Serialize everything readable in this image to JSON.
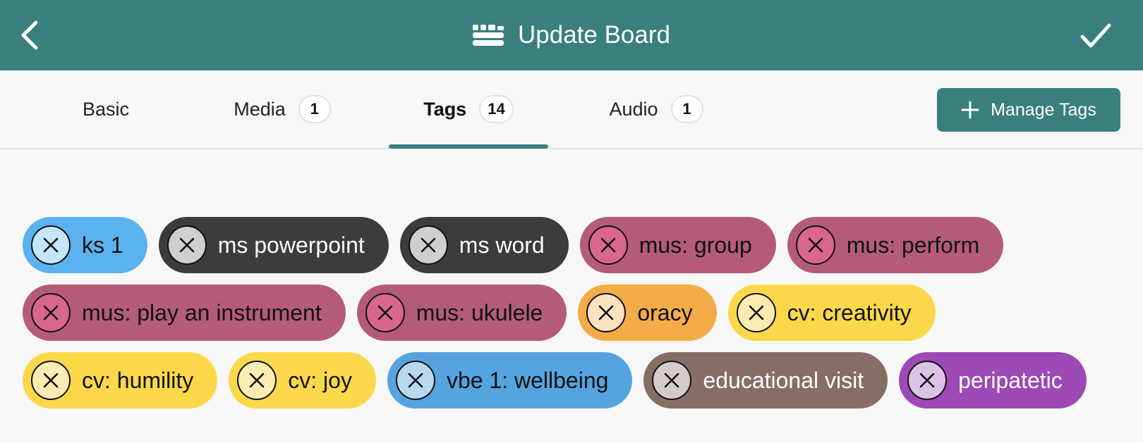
{
  "header": {
    "title": "Update Board",
    "back_icon": "chevron-left-icon",
    "board_icon": "board-icon",
    "confirm_icon": "checkmark-icon",
    "bg_color": "#397f7e"
  },
  "tabs": [
    {
      "label": "Basic",
      "count": null,
      "active": false
    },
    {
      "label": "Media",
      "count": "1",
      "active": false
    },
    {
      "label": "Tags",
      "count": "14",
      "active": true
    },
    {
      "label": "Audio",
      "count": "1",
      "active": false
    }
  ],
  "manage_tags": {
    "label": "Manage Tags",
    "icon": "plus-icon"
  },
  "tags": [
    {
      "label": "ks 1",
      "bg": "#5bb2ef",
      "circle": "#c4e5fa",
      "text": "#111111"
    },
    {
      "label": "ms powerpoint",
      "bg": "#3c3c3c",
      "circle": "#cfcfcf",
      "text": "#ffffff"
    },
    {
      "label": "ms word",
      "bg": "#3c3c3c",
      "circle": "#cfcfcf",
      "text": "#ffffff"
    },
    {
      "label": "mus: group",
      "bg": "#b45b7b",
      "circle": "#d8668f",
      "text": "#111111"
    },
    {
      "label": "mus: perform",
      "bg": "#b45b7b",
      "circle": "#d8668f",
      "text": "#111111"
    },
    {
      "label": "mus: play an instrument",
      "bg": "#b45b7b",
      "circle": "#d8668f",
      "text": "#111111"
    },
    {
      "label": "mus: ukulele",
      "bg": "#b45b7b",
      "circle": "#d8668f",
      "text": "#111111"
    },
    {
      "label": "oracy",
      "bg": "#f3ac48",
      "circle": "#fce2c0",
      "text": "#111111"
    },
    {
      "label": "cv: creativity",
      "bg": "#fad84a",
      "circle": "#fcecb2",
      "text": "#111111"
    },
    {
      "label": "cv: humility",
      "bg": "#fad84a",
      "circle": "#fcecb2",
      "text": "#111111"
    },
    {
      "label": "cv: joy",
      "bg": "#fad84a",
      "circle": "#fcecb2",
      "text": "#111111"
    },
    {
      "label": "vbe 1: wellbeing",
      "bg": "#55a4e0",
      "circle": "#b7d8ee",
      "text": "#111111"
    },
    {
      "label": "educational visit",
      "bg": "#876e64",
      "circle": "#d5cbc8",
      "text": "#ffffff"
    },
    {
      "label": "peripatetic",
      "bg": "#9d49b6",
      "circle": "#dcc3e6",
      "text": "#ffffff"
    }
  ]
}
